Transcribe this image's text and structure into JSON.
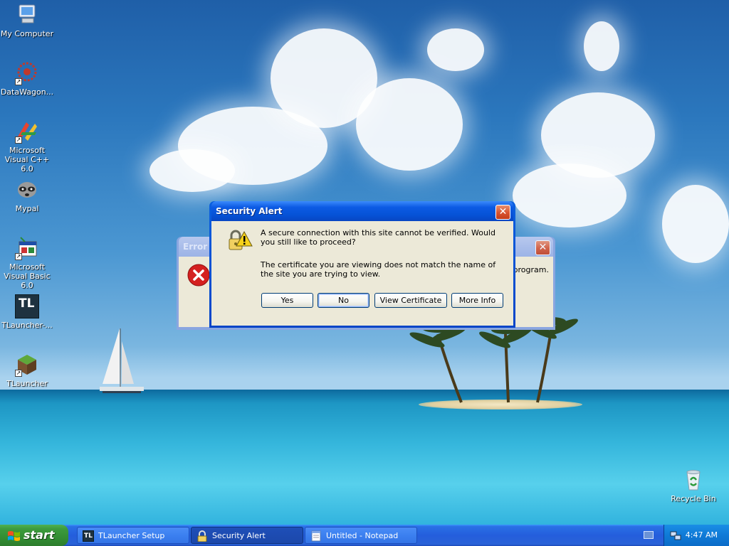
{
  "desktop": {
    "icons": [
      {
        "label": "My Computer"
      },
      {
        "label": "DataWagon..."
      },
      {
        "label": "Microsoft Visual C++ 6.0"
      },
      {
        "label": "Mypal"
      },
      {
        "label": "Microsoft Visual Basic 6.0"
      },
      {
        "label": "TLauncher-..."
      },
      {
        "label": "TLauncher"
      },
      {
        "label": "Recycle Bin"
      }
    ],
    "tl_logo_text": "TL"
  },
  "error_dialog": {
    "title": "Error D",
    "message_tail": "program.",
    "close_glyph": "✕"
  },
  "security_alert": {
    "title": "Security Alert",
    "close_glyph": "✕",
    "message1": "A secure connection with this site cannot be verified. Would you still like to proceed?",
    "message2": "The certificate you are viewing does not match the name of the site you are trying to view.",
    "buttons": {
      "yes": "Yes",
      "no": "No",
      "view_certificate": "View Certificate",
      "more_info": "More Info"
    }
  },
  "taskbar": {
    "start_label": "start",
    "tasks": [
      {
        "label": "TLauncher Setup",
        "icon": "tlauncher-icon"
      },
      {
        "label": "Security Alert",
        "icon": "lock-icon"
      },
      {
        "label": "Untitled - Notepad",
        "icon": "notepad-icon"
      }
    ],
    "task_tl_text": "TL",
    "clock": "4:47 AM"
  },
  "colors": {
    "titlebar_active": "#0552d6",
    "taskbar": "#245edc",
    "start_green": "#3c9b3c",
    "dialog_bg": "#ece9d8"
  }
}
